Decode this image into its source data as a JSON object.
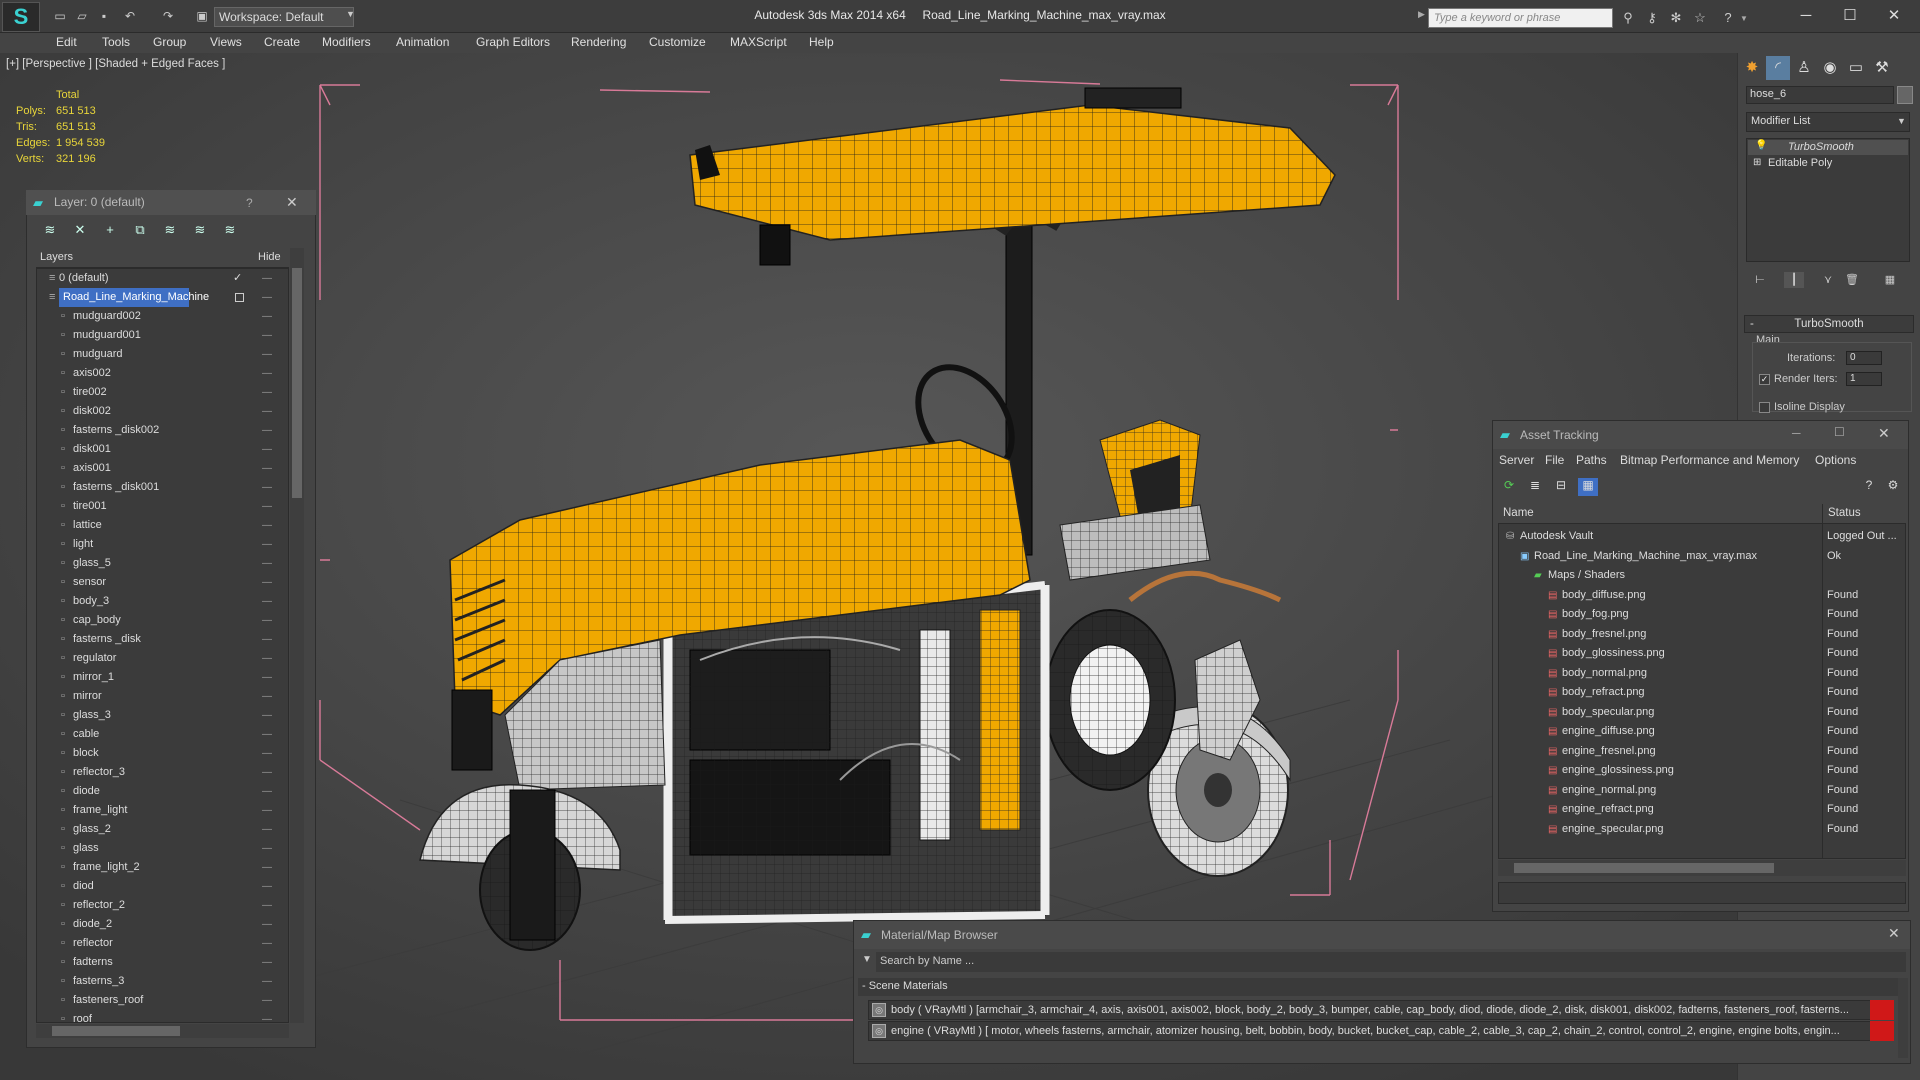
{
  "app": {
    "title": "Autodesk 3ds Max  2014 x64",
    "file": "Road_Line_Marking_Machine_max_vray.max",
    "workspace": "Workspace: Default",
    "search_placeholder": "Type a keyword or phrase",
    "window_controls": [
      "minimize-icon",
      "maximize-icon",
      "close-icon"
    ]
  },
  "menu": [
    "Edit",
    "Tools",
    "Group",
    "Views",
    "Create",
    "Modifiers",
    "Animation",
    "Graph Editors",
    "Rendering",
    "Customize",
    "MAXScript",
    "Help"
  ],
  "viewport": {
    "label": "[+] [Perspective ] [Shaded + Edged Faces ]",
    "stats": {
      "header": "Total",
      "rows": [
        {
          "label": "Polys:",
          "value": "651 513"
        },
        {
          "label": "Tris:",
          "value": "651 513"
        },
        {
          "label": "Edges:",
          "value": "1 954 539"
        },
        {
          "label": "Verts:",
          "value": "321 196"
        }
      ]
    },
    "colors": {
      "body": "#f0a800",
      "wire": "#1a1a1a",
      "bbox": "#d87a98"
    }
  },
  "command_panel": {
    "object_name": "hose_6",
    "modifier_list": "Modifier List",
    "stack": [
      "TurboSmooth",
      "Editable Poly"
    ],
    "rollout_title": "TurboSmooth",
    "section": "Main",
    "iterations_label": "Iterations:",
    "iterations_value": "0",
    "render_iters_label": "Render Iters:",
    "render_iters_value": "1",
    "isoline_label": "Isoline Display"
  },
  "layer_panel": {
    "title": "Layer: 0 (default)",
    "help": "?",
    "col_layers": "Layers",
    "col_hide": "Hide",
    "rows": [
      {
        "name": "0 (default)",
        "level": 0
      },
      {
        "name": "Road_Line_Marking_Machine",
        "level": 0,
        "selected": true
      },
      {
        "name": "mudguard002",
        "level": 1
      },
      {
        "name": "mudguard001",
        "level": 1
      },
      {
        "name": "mudguard",
        "level": 1
      },
      {
        "name": "axis002",
        "level": 1
      },
      {
        "name": "tire002",
        "level": 1
      },
      {
        "name": "disk002",
        "level": 1
      },
      {
        "name": "fasterns _disk002",
        "level": 1
      },
      {
        "name": "disk001",
        "level": 1
      },
      {
        "name": "axis001",
        "level": 1
      },
      {
        "name": "fasterns _disk001",
        "level": 1
      },
      {
        "name": "tire001",
        "level": 1
      },
      {
        "name": "lattice",
        "level": 1
      },
      {
        "name": "light",
        "level": 1
      },
      {
        "name": "glass_5",
        "level": 1
      },
      {
        "name": "sensor",
        "level": 1
      },
      {
        "name": "body_3",
        "level": 1
      },
      {
        "name": "cap_body",
        "level": 1
      },
      {
        "name": "fasterns _disk",
        "level": 1
      },
      {
        "name": "regulator",
        "level": 1
      },
      {
        "name": "mirror_1",
        "level": 1
      },
      {
        "name": "mirror",
        "level": 1
      },
      {
        "name": "glass_3",
        "level": 1
      },
      {
        "name": "cable",
        "level": 1
      },
      {
        "name": "block",
        "level": 1
      },
      {
        "name": "reflector_3",
        "level": 1
      },
      {
        "name": "diode",
        "level": 1
      },
      {
        "name": "frame_light",
        "level": 1
      },
      {
        "name": "glass_2",
        "level": 1
      },
      {
        "name": "glass",
        "level": 1
      },
      {
        "name": "frame_light_2",
        "level": 1
      },
      {
        "name": "diod",
        "level": 1
      },
      {
        "name": "reflector_2",
        "level": 1
      },
      {
        "name": "diode_2",
        "level": 1
      },
      {
        "name": "reflector",
        "level": 1
      },
      {
        "name": "fadterns",
        "level": 1
      },
      {
        "name": "fasterns_3",
        "level": 1
      },
      {
        "name": "fasteners_roof",
        "level": 1
      },
      {
        "name": "roof",
        "level": 1
      }
    ]
  },
  "asset_tracking": {
    "title": "Asset Tracking",
    "menu": [
      "Server",
      "File",
      "Paths",
      "Bitmap Performance and Memory",
      "Options"
    ],
    "col_name": "Name",
    "col_status": "Status",
    "rows": [
      {
        "name": "Autodesk Vault",
        "status": "Logged Out ...",
        "level": 0
      },
      {
        "name": "Road_Line_Marking_Machine_max_vray.max",
        "status": "Ok",
        "level": 1
      },
      {
        "name": "Maps / Shaders",
        "status": "",
        "level": 2
      },
      {
        "name": "body_diffuse.png",
        "status": "Found",
        "level": 3
      },
      {
        "name": "body_fog.png",
        "status": "Found",
        "level": 3
      },
      {
        "name": "body_fresnel.png",
        "status": "Found",
        "level": 3
      },
      {
        "name": "body_glossiness.png",
        "status": "Found",
        "level": 3
      },
      {
        "name": "body_normal.png",
        "status": "Found",
        "level": 3
      },
      {
        "name": "body_refract.png",
        "status": "Found",
        "level": 3
      },
      {
        "name": "body_specular.png",
        "status": "Found",
        "level": 3
      },
      {
        "name": "engine_diffuse.png",
        "status": "Found",
        "level": 3
      },
      {
        "name": "engine_fresnel.png",
        "status": "Found",
        "level": 3
      },
      {
        "name": "engine_glossiness.png",
        "status": "Found",
        "level": 3
      },
      {
        "name": "engine_normal.png",
        "status": "Found",
        "level": 3
      },
      {
        "name": "engine_refract.png",
        "status": "Found",
        "level": 3
      },
      {
        "name": "engine_specular.png",
        "status": "Found",
        "level": 3
      }
    ]
  },
  "material_browser": {
    "title": "Material/Map Browser",
    "search_placeholder": "Search by Name ...",
    "section": "- Scene Materials",
    "rows": [
      "body  ( VRayMtl ) [armchair_3, armchair_4, axis, axis001, axis002, block, body_2, body_3, bumper, cable, cap_body, diod, diode, diode_2, disk, disk001, disk002, fadterns, fasteners_roof, fasterns...",
      "engine  ( VRayMtl ) [ motor,  wheels fasterns, armchair, atomizer housing, belt, bobbin, body, bucket, bucket_cap, cable_2, cable_3, cap_2, chain_2, control, control_2, engine, engine bolts, engin..."
    ]
  }
}
